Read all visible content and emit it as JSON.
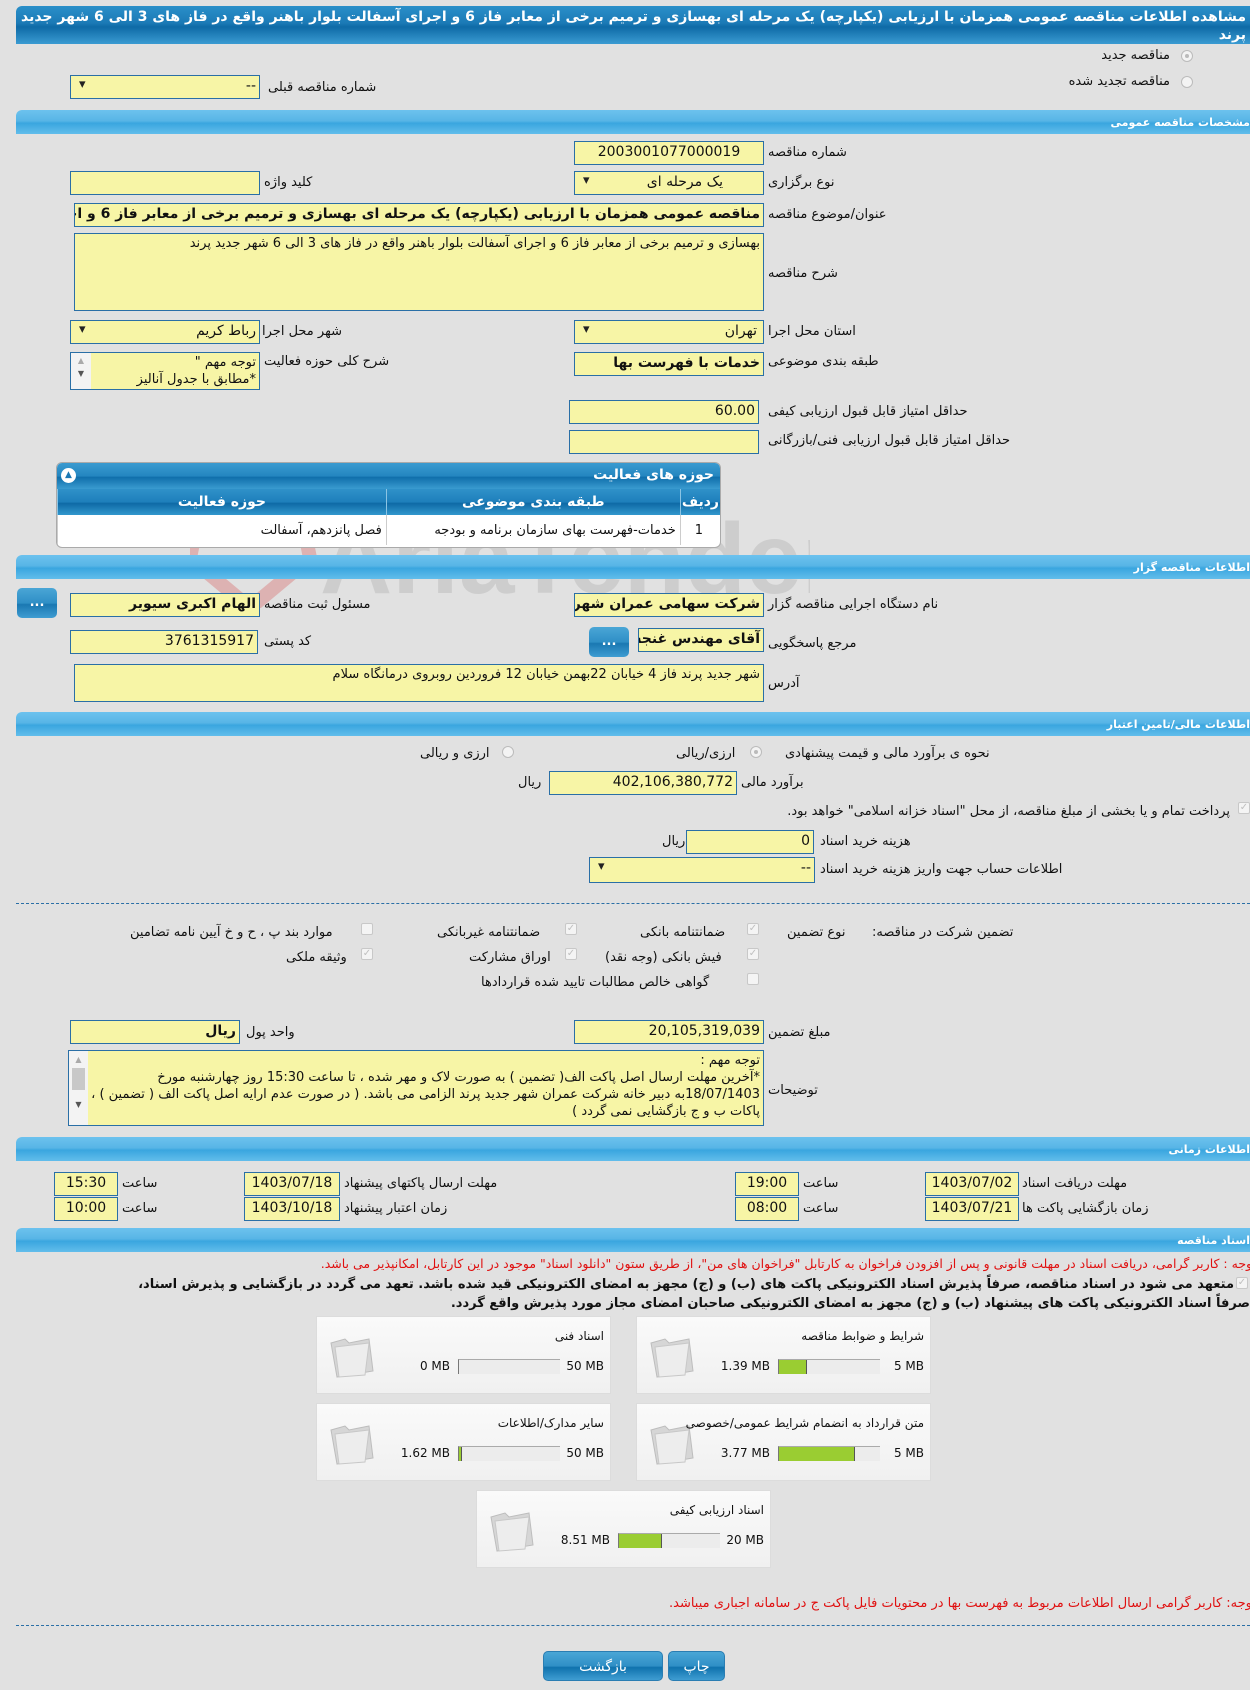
{
  "page": {
    "title": "مشاهده اطلاعات مناقصه عمومی همزمان با ارزیابی (یکپارچه) یک مرحله ای بهسازی و ترمیم برخی از معابر فاز 6 و اجرای آسفالت بلوار باهنر واقع در فاز های 3 الی 6 شهر جدید پرند"
  },
  "tender_type": {
    "new_label": "مناقصه جدید",
    "renewed_label": "مناقصه تجدید شده",
    "selected": "new",
    "previous_number_label": "شماره مناقصه قبلی",
    "previous_number_value": "--"
  },
  "general": {
    "section_title": "مشخصات مناقصه عمومی",
    "tender_number_label": "شماره مناقصه",
    "tender_number": "2003001077000019",
    "holding_type_label": "نوع برگزاری",
    "holding_type": "یک مرحله ای",
    "keyword_label": "کلید واژه",
    "keyword": "",
    "subject_label": "عنوان/موضوع مناقصه",
    "subject": "مناقصه عمومی همزمان با ارزیابی (یکپارچه) یک مرحله ای بهسازی و ترمیم برخی از معابر فاز 6 و اجرای آسفالت بلوار باهنر واقع در فاز های 3 الی 6 شهر جدید پرند",
    "description_label": "شرح مناقصه",
    "description": "بهسازی و ترمیم برخی از معابر فاز 6 و اجرای آسفالت بلوار باهنر واقع در فاز های 3 الی 6 شهر جدید پرند",
    "province_label": "استان محل اجرا",
    "province": "تهران",
    "city_label": "شهر محل اجرا",
    "city": "رباط کریم",
    "category_label": "طبقه بندی موضوعی",
    "category": "خدمات با فهرست بها",
    "activity_desc_label": "شرح کلی حوزه فعالیت",
    "activity_desc": "توجه مهم \"\n*مطابق با جدول آنالیز",
    "min_quality_score_label": "حداقل امتیاز قابل قبول ارزیابی کیفی",
    "min_quality_score": "60.00",
    "min_tech_score_label": "حداقل امتیاز قابل قبول ارزیابی فنی/بازرگانی",
    "min_tech_score": ""
  },
  "activities": {
    "title": "حوزه های فعالیت",
    "columns": [
      "ردیف",
      "طبقه بندی موضوعی",
      "حوزه فعالیت"
    ],
    "rows": [
      {
        "index": "1",
        "category": "خدمات-فهرست بهای سازمان برنامه و بودجه",
        "field": "فصل پانزدهم، آسفالت"
      }
    ]
  },
  "organizer": {
    "section_title": "اطلاعات مناقصه گزار",
    "org_name_label": "نام دستگاه اجرایی مناقصه گزار",
    "org_name": "شرکت سهامی عمران شهر جدید پرند",
    "registrar_label": "مسئول ثبت مناقصه",
    "registrar": "الهام  اکبری سیویر",
    "contact_label": "مرجع پاسخگویی",
    "contact": "آقای مهندس غنجه",
    "postal_code_label": "کد پستی",
    "postal_code": "3761315917",
    "address_label": "آدرس",
    "address": "شهر جدید پرند فاز 4 خیابان 22بهمن خیابان 12 فروردین روبروی درمانگاه سلام",
    "more_button": "..."
  },
  "financial": {
    "section_title": "اطلاعات مالی/تامین اعتبار",
    "method_label": "نحوه ی برآورد مالی و قیمت پیشنهادی",
    "option_rial": "ارزی/ریالی",
    "option_both": "ارزی و ریالی",
    "estimate_label": "برآورد مالی",
    "estimate": "402,106,380,772",
    "currency": "ریال",
    "islamic_treasury_text": "پرداخت تمام و یا بخشی از مبلغ مناقصه، از محل \"اسناد خزانه اسلامی\" خواهد بود.",
    "doc_cost_label": "هزینه خرید اسناد",
    "doc_cost": "0",
    "doc_account_label": "اطلاعات حساب جهت واریز هزینه خرید اسناد",
    "doc_account": "--"
  },
  "guarantee": {
    "label": "تضمین شرکت در مناقصه:",
    "type_label": "نوع تضمین",
    "options": [
      {
        "label": "ضمانتنامه بانکی",
        "checked": true
      },
      {
        "label": "ضمانتنامه غیربانکی",
        "checked": true
      },
      {
        "label": "موارد بند پ ، ح و خ آیین نامه تضامین",
        "checked": false
      },
      {
        "label": "فیش بانکی (وجه نقد)",
        "checked": true
      },
      {
        "label": "اوراق مشارکت",
        "checked": true
      },
      {
        "label": "وثیقه ملکی",
        "checked": true
      },
      {
        "label": "گواهی خالص مطالبات تایید شده قراردادها",
        "checked": false
      }
    ],
    "amount_label": "مبلغ تضمین",
    "amount": "20,105,319,039",
    "currency_label": "واحد پول",
    "currency": "ریال",
    "notes_label": "توضیحات",
    "notes": "توجه مهم :\n*آخرین مهلت ارسال اصل پاکت الف( تضمین ) به صورت لاک و مهر شده ، تا ساعت 15:30 روز چهارشنبه مورخ 18/07/1403به دبیر خانه شرکت عمران شهر جدید پرند الزامی می باشد. ( در صورت عدم ارایه اصل پاکت الف ( تضمین ) ، پاکات ب و ج بازگشایی نمی گردد )"
  },
  "timing": {
    "section_title": "اطلاعات زمانی",
    "doc_deadline_label": "مهلت دریافت اسناد",
    "doc_deadline_date": "1403/07/02",
    "doc_deadline_time": "19:00",
    "submit_deadline_label": "مهلت ارسال پاکتهای پیشنهاد",
    "submit_deadline_date": "1403/07/18",
    "submit_deadline_time": "15:30",
    "opening_label": "زمان بازگشایی پاکت ها",
    "opening_date": "1403/07/21",
    "opening_time": "08:00",
    "validity_label": "زمان اعتبار پیشنهاد",
    "validity_date": "1403/10/18",
    "validity_time": "10:00",
    "time_label": "ساعت"
  },
  "documents": {
    "section_title": "اسناد مناقصه",
    "notice": "توجه : کاربر گرامی، دریافت اسناد در مهلت قانونی و پس از افزودن فراخوان به کارتابل \"فراخوان های من\"، از طریق ستون \"دانلود اسناد\" موجود در این کارتابل، امکانپذیر می باشد.",
    "commitment_line1": "متعهد می شود در اسناد مناقصه، صرفاً پذیرش اسناد الکترونیکی پاکت های (ب) و (ج) مجهز به امضای الکترونیکی قید شده باشد. تعهد می گردد در بازگشایی و پذیرش اسناد،",
    "commitment_line2": "صرفاً اسناد الکترونیکی پاکت های پیشنهاد (ب) و (ج) مجهز به امضای الکترونیکی صاحبان امضای مجاز مورد پذیرش واقع گردد.",
    "files": [
      {
        "name": "شرایط و ضوابط مناقصه",
        "current": "1.39 MB",
        "max": "5 MB",
        "fraction": 0.278
      },
      {
        "name": "اسناد فنی",
        "current": "0 MB",
        "max": "50 MB",
        "fraction": 0.0
      },
      {
        "name": "متن قرارداد به انضمام شرایط عمومی/خصوصی",
        "current": "3.77 MB",
        "max": "5 MB",
        "fraction": 0.754
      },
      {
        "name": "سایر مدارک/اطلاعات",
        "current": "1.62 MB",
        "max": "50 MB",
        "fraction": 0.032
      },
      {
        "name": "اسناد ارزیابی کیفی",
        "current": "8.51 MB",
        "max": "20 MB",
        "fraction": 0.4255
      }
    ],
    "footer_notice": "توجه: کاربر گرامی ارسال اطلاعات مربوط به فهرست بها در محتویات فایل پاکت ج در سامانه اجباری میباشد."
  },
  "actions": {
    "print": "چاپ",
    "back": "بازگشت"
  },
  "watermark": "AriaTender.neT"
}
